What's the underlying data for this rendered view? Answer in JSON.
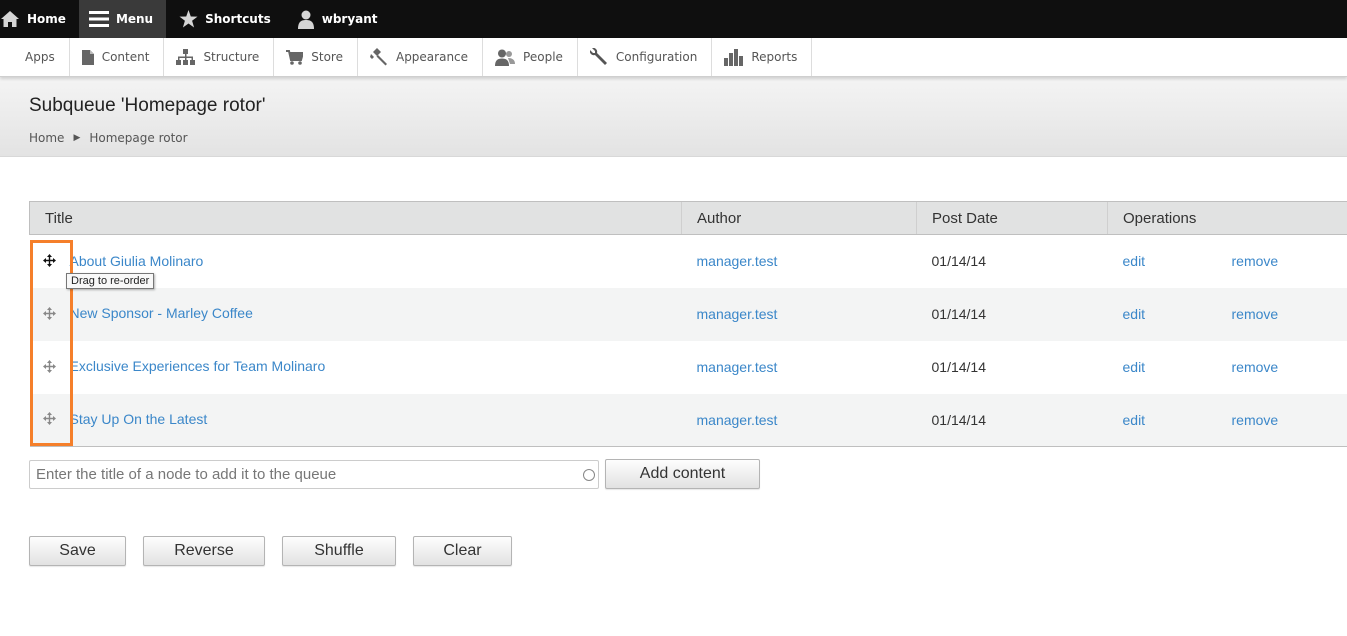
{
  "toolbar": {
    "home": "Home",
    "menu": "Menu",
    "shortcuts": "Shortcuts",
    "user": "wbryant"
  },
  "tray": {
    "items": [
      "Apps",
      "Content",
      "Structure",
      "Store",
      "Appearance",
      "People",
      "Configuration",
      "Reports"
    ]
  },
  "header": {
    "title": "Subqueue 'Homepage rotor'",
    "breadcrumb": [
      "Home",
      "Homepage rotor"
    ]
  },
  "table": {
    "columns": [
      "Title",
      "Author",
      "Post Date",
      "Operations"
    ],
    "rows": [
      {
        "title": "About Giulia Molinaro",
        "author": "manager.test",
        "date": "01/14/14",
        "edit": "edit",
        "remove": "remove"
      },
      {
        "title": "New Sponsor - Marley Coffee",
        "author": "manager.test",
        "date": "01/14/14",
        "edit": "edit",
        "remove": "remove"
      },
      {
        "title": "Exclusive Experiences for Team Molinaro",
        "author": "manager.test",
        "date": "01/14/14",
        "edit": "edit",
        "remove": "remove"
      },
      {
        "title": "Stay Up On the Latest",
        "author": "manager.test",
        "date": "01/14/14",
        "edit": "edit",
        "remove": "remove"
      }
    ],
    "tooltip": "Drag to re-order"
  },
  "add": {
    "placeholder": "Enter the title of a node to add it to the queue",
    "button": "Add content"
  },
  "actions": {
    "save": "Save",
    "reverse": "Reverse",
    "shuffle": "Shuffle",
    "clear": "Clear"
  },
  "colors": {
    "link": "#3b87c9",
    "highlight": "#f57f2a",
    "toolbar": "#0f0f0f"
  }
}
